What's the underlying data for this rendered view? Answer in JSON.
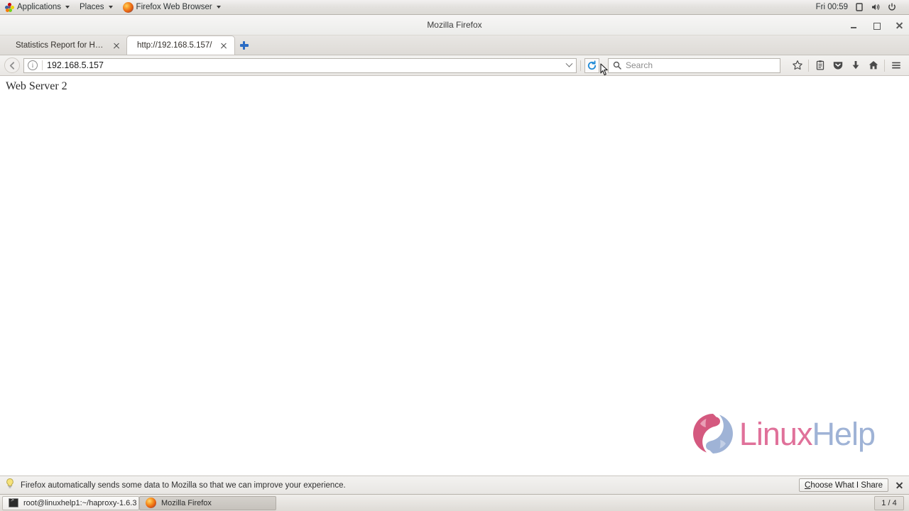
{
  "desktop": {
    "panel": {
      "applications_label": "Applications",
      "places_label": "Places",
      "active_app_label": "Firefox Web Browser",
      "clock": "Fri 00:59",
      "tray": [
        "display-icon",
        "volume-icon",
        "power-icon"
      ]
    },
    "taskbar": {
      "tasks": [
        {
          "label": "root@linuxhelp1:~/haproxy-1.6.3",
          "icon": "terminal-icon",
          "active": false
        },
        {
          "label": "Mozilla Firefox",
          "icon": "firefox-icon",
          "active": true
        }
      ],
      "workspace": "1 / 4"
    }
  },
  "browser": {
    "window_title": "Mozilla Firefox",
    "window_controls": {
      "minimize": "minimize-button",
      "maximize": "maximize-button",
      "close": "close-button"
    },
    "tabs": [
      {
        "label": "Statistics Report for HA...",
        "active": false
      },
      {
        "label": "http://192.168.5.157/",
        "active": true
      }
    ],
    "new_tab_label": "+",
    "navbar": {
      "url_value": "192.168.5.157",
      "search_placeholder": "Search",
      "identity_icon": "info-icon",
      "back_icon": "back-arrow-icon",
      "reload_icon": "reload-icon",
      "dropmarker_icon": "chevron-down-icon",
      "search_icon": "search-icon",
      "toolbar_icons": [
        "bookmark-star-icon",
        "library-icon",
        "pocket-icon",
        "downloads-icon",
        "home-icon",
        "menu-hamburger-icon"
      ]
    },
    "page": {
      "heading": "Web Server 2",
      "watermark": {
        "name_first": "Linux",
        "name_second": "Help",
        "pink": "#e0719a",
        "blue": "#9fb3d6"
      }
    },
    "notification": {
      "icon": "lightbulb-icon",
      "message": "Firefox automatically sends some data to Mozilla so that we can improve your experience.",
      "button_accesskey": "C",
      "button_label_rest": "hoose What I Share",
      "close_icon": "close-icon"
    }
  }
}
